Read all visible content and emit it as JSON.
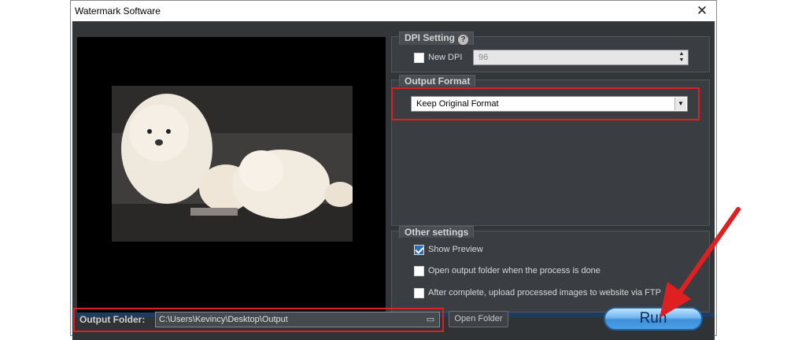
{
  "window": {
    "title": "Watermark Software"
  },
  "dpi_setting": {
    "legend": "DPI Setting",
    "new_dpi_label": "New DPI",
    "new_dpi_checked": false,
    "dpi_value": "96"
  },
  "output_format": {
    "legend": "Output Format",
    "selected": "Keep Original Format"
  },
  "other_settings": {
    "legend": "Other settings",
    "show_preview_label": "Show Preview",
    "show_preview_checked": true,
    "open_output_label": "Open output folder when the process is done",
    "open_output_checked": false,
    "upload_ftp_label": "After complete, upload processed images to website via FTP",
    "upload_ftp_checked": false
  },
  "output_folder": {
    "label": "Output Folder:",
    "path": "C:\\Users\\Kevincy\\Desktop\\Output",
    "open_button": "Open Folder"
  },
  "run_button": {
    "label": "Run"
  },
  "colors": {
    "accent_red": "#e02020",
    "run_blue": "#4aa0e6",
    "panel_dark": "#323639"
  },
  "icons": [
    "close-icon",
    "help-icon",
    "checkbox-icon",
    "dropdown-arrow-icon",
    "spinner-icon",
    "folder-browse-icon"
  ]
}
